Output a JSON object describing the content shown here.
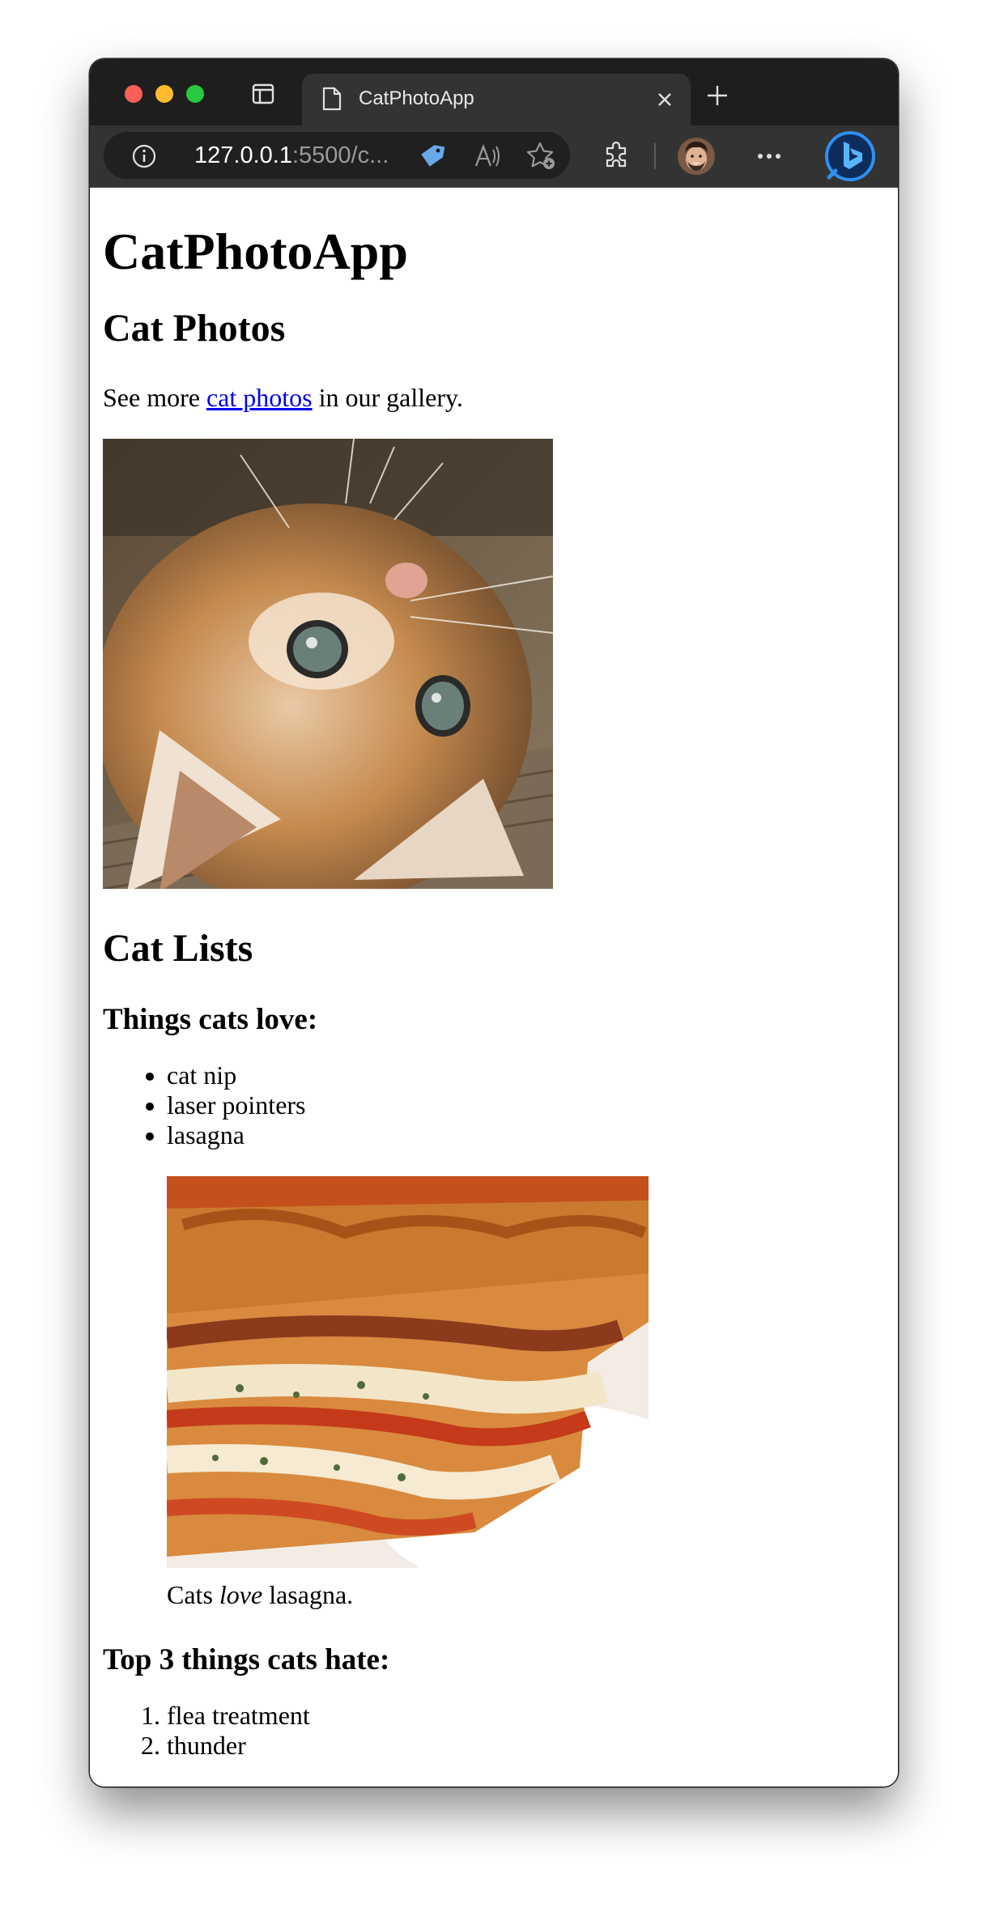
{
  "browser": {
    "tab_title": "CatPhotoApp",
    "url_host": "127.0.0.1",
    "url_rest": ":5500/c..."
  },
  "page": {
    "title": "CatPhotoApp",
    "photos_heading": "Cat Photos",
    "intro_before": "See more ",
    "intro_link": "cat photos",
    "intro_after": " in our gallery.",
    "lists_heading": "Cat Lists",
    "love_heading": "Things cats love:",
    "love_items": [
      "cat nip",
      "laser pointers",
      "lasagna"
    ],
    "caption_before": "Cats ",
    "caption_em": "love",
    "caption_after": " lasagna.",
    "hate_heading": "Top 3 things cats hate:",
    "hate_items": [
      "flea treatment",
      "thunder"
    ]
  },
  "colors": {
    "link": "#0000ee",
    "browser_chrome": "#333333"
  }
}
